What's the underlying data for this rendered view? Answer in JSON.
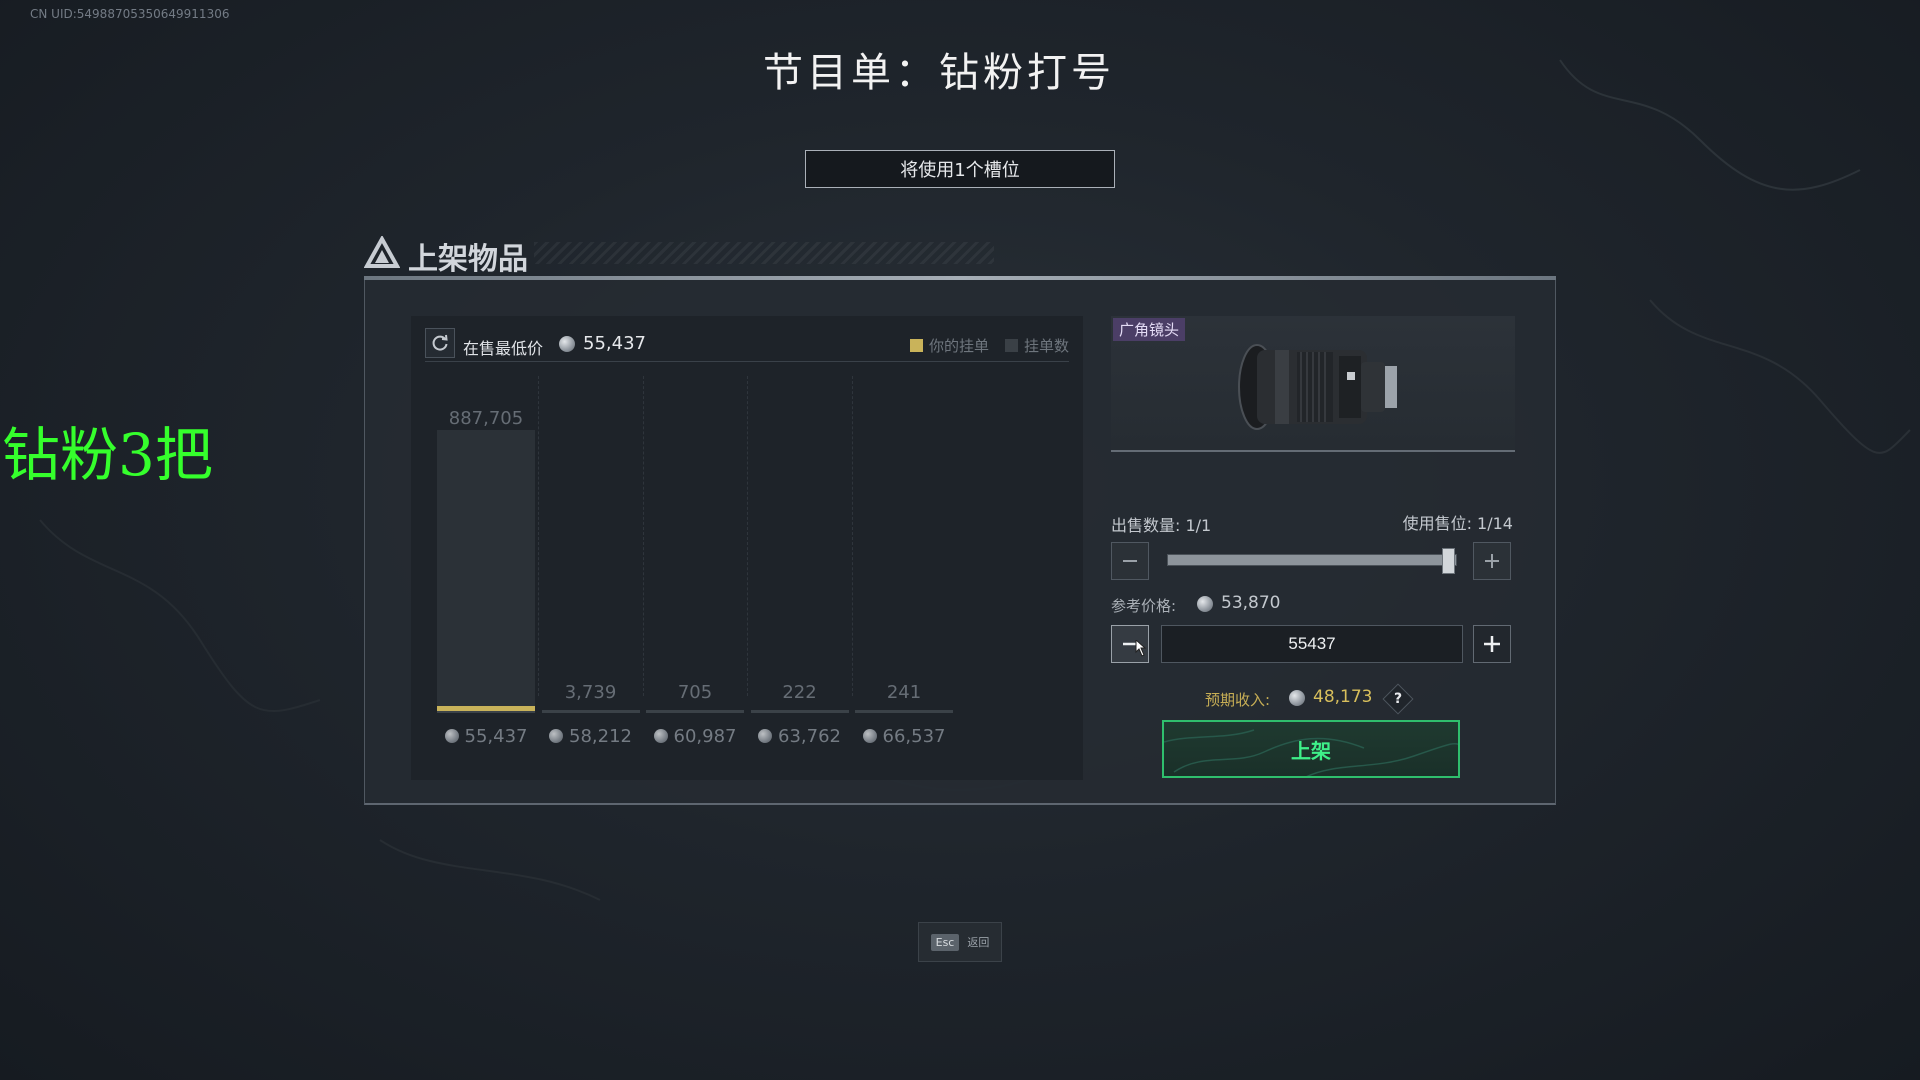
{
  "uid": "CN UID:54988705350649911306",
  "program_title": "节目单：钻粉打号",
  "slot_notice": "将使用1个槽位",
  "overlay_note": "钻粉3把",
  "panel": {
    "title": "上架物品",
    "chart": {
      "lowest_label": "在售最低价",
      "lowest_price": "55,437",
      "legend": {
        "own": "你的挂单",
        "count": "挂单数"
      },
      "colors": {
        "own": "#c9b35a",
        "count": "#3a4046"
      }
    },
    "item": {
      "tag": "广角镜头"
    },
    "quantity_label": "出售数量: 1/1",
    "slots_label": "使用售位: 1/14",
    "quantity": {
      "value": 1,
      "max": 1
    },
    "reference_label": "参考价格:",
    "reference_price": "53,870",
    "price_input": "55437",
    "income_label": "预期收入:",
    "income_value": "48,173",
    "help_symbol": "?",
    "list_button": "上架"
  },
  "esc": {
    "key": "Esc",
    "label": "返回"
  },
  "chart_data": {
    "type": "bar",
    "categories": [
      "55,437",
      "58,212",
      "60,987",
      "63,762",
      "66,537"
    ],
    "series": [
      {
        "name": "挂单数",
        "values": [
          887705,
          3739,
          705,
          222,
          241
        ]
      }
    ],
    "data_labels": [
      "887,705",
      "3,739",
      "705",
      "222",
      "241"
    ],
    "own_listing_category": "55,437",
    "legend": [
      "你的挂单",
      "挂单数"
    ],
    "legend_position": "top-right"
  }
}
